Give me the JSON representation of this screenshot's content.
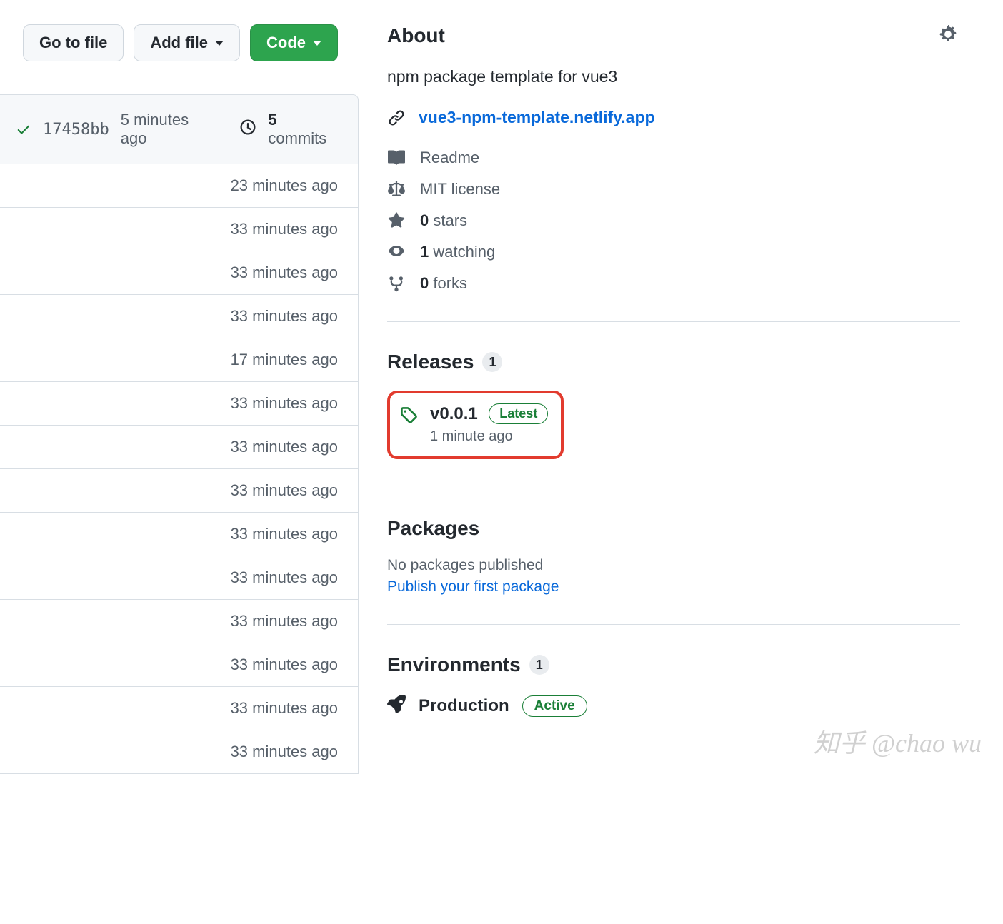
{
  "buttons": {
    "go_to_file": "Go to file",
    "add_file": "Add file",
    "code": "Code"
  },
  "commit_summary": {
    "sha": "17458bb",
    "time": "5 minutes ago",
    "count": "5",
    "count_label": "commits"
  },
  "file_times": [
    "23 minutes ago",
    "33 minutes ago",
    "33 minutes ago",
    "33 minutes ago",
    "17 minutes ago",
    "33 minutes ago",
    "33 minutes ago",
    "33 minutes ago",
    "33 minutes ago",
    "33 minutes ago",
    "33 minutes ago",
    "33 minutes ago",
    "33 minutes ago",
    "33 minutes ago"
  ],
  "about": {
    "heading": "About",
    "description": "npm package template for vue3",
    "homepage": "vue3-npm-template.netlify.app",
    "readme": "Readme",
    "license": "MIT license",
    "stars_count": "0",
    "stars_label": "stars",
    "watching_count": "1",
    "watching_label": "watching",
    "forks_count": "0",
    "forks_label": "forks"
  },
  "releases": {
    "heading": "Releases",
    "count": "1",
    "version": "v0.0.1",
    "latest_label": "Latest",
    "time": "1 minute ago"
  },
  "packages": {
    "heading": "Packages",
    "empty": "No packages published",
    "cta": "Publish your first package"
  },
  "environments": {
    "heading": "Environments",
    "count": "1",
    "name": "Production",
    "status": "Active"
  },
  "watermark": "知乎 @chao wu"
}
